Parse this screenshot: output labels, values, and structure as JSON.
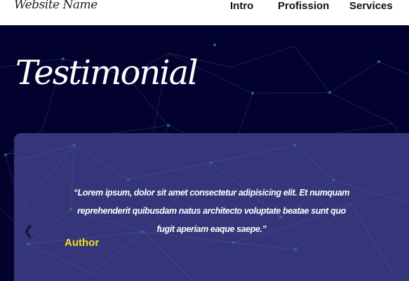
{
  "nav": {
    "brand": "Website Name",
    "links": [
      "Intro",
      "Profission",
      "Services"
    ]
  },
  "hero": {
    "title": "Testimonial"
  },
  "testimonial": {
    "quote_lines": [
      "“Lorem ipsum, dolor sit amet consectetur adipisicing elit. Et numquam",
      "reprehenderit quibusdam natus architecto voluptate beatae sunt quo",
      "fugit aperiam eaque saepe.”"
    ],
    "author": "Author",
    "prev_icon": "chevron-left-icon"
  },
  "colors": {
    "background": "#03022e",
    "card": "#343679",
    "author": "#f2e11c"
  }
}
